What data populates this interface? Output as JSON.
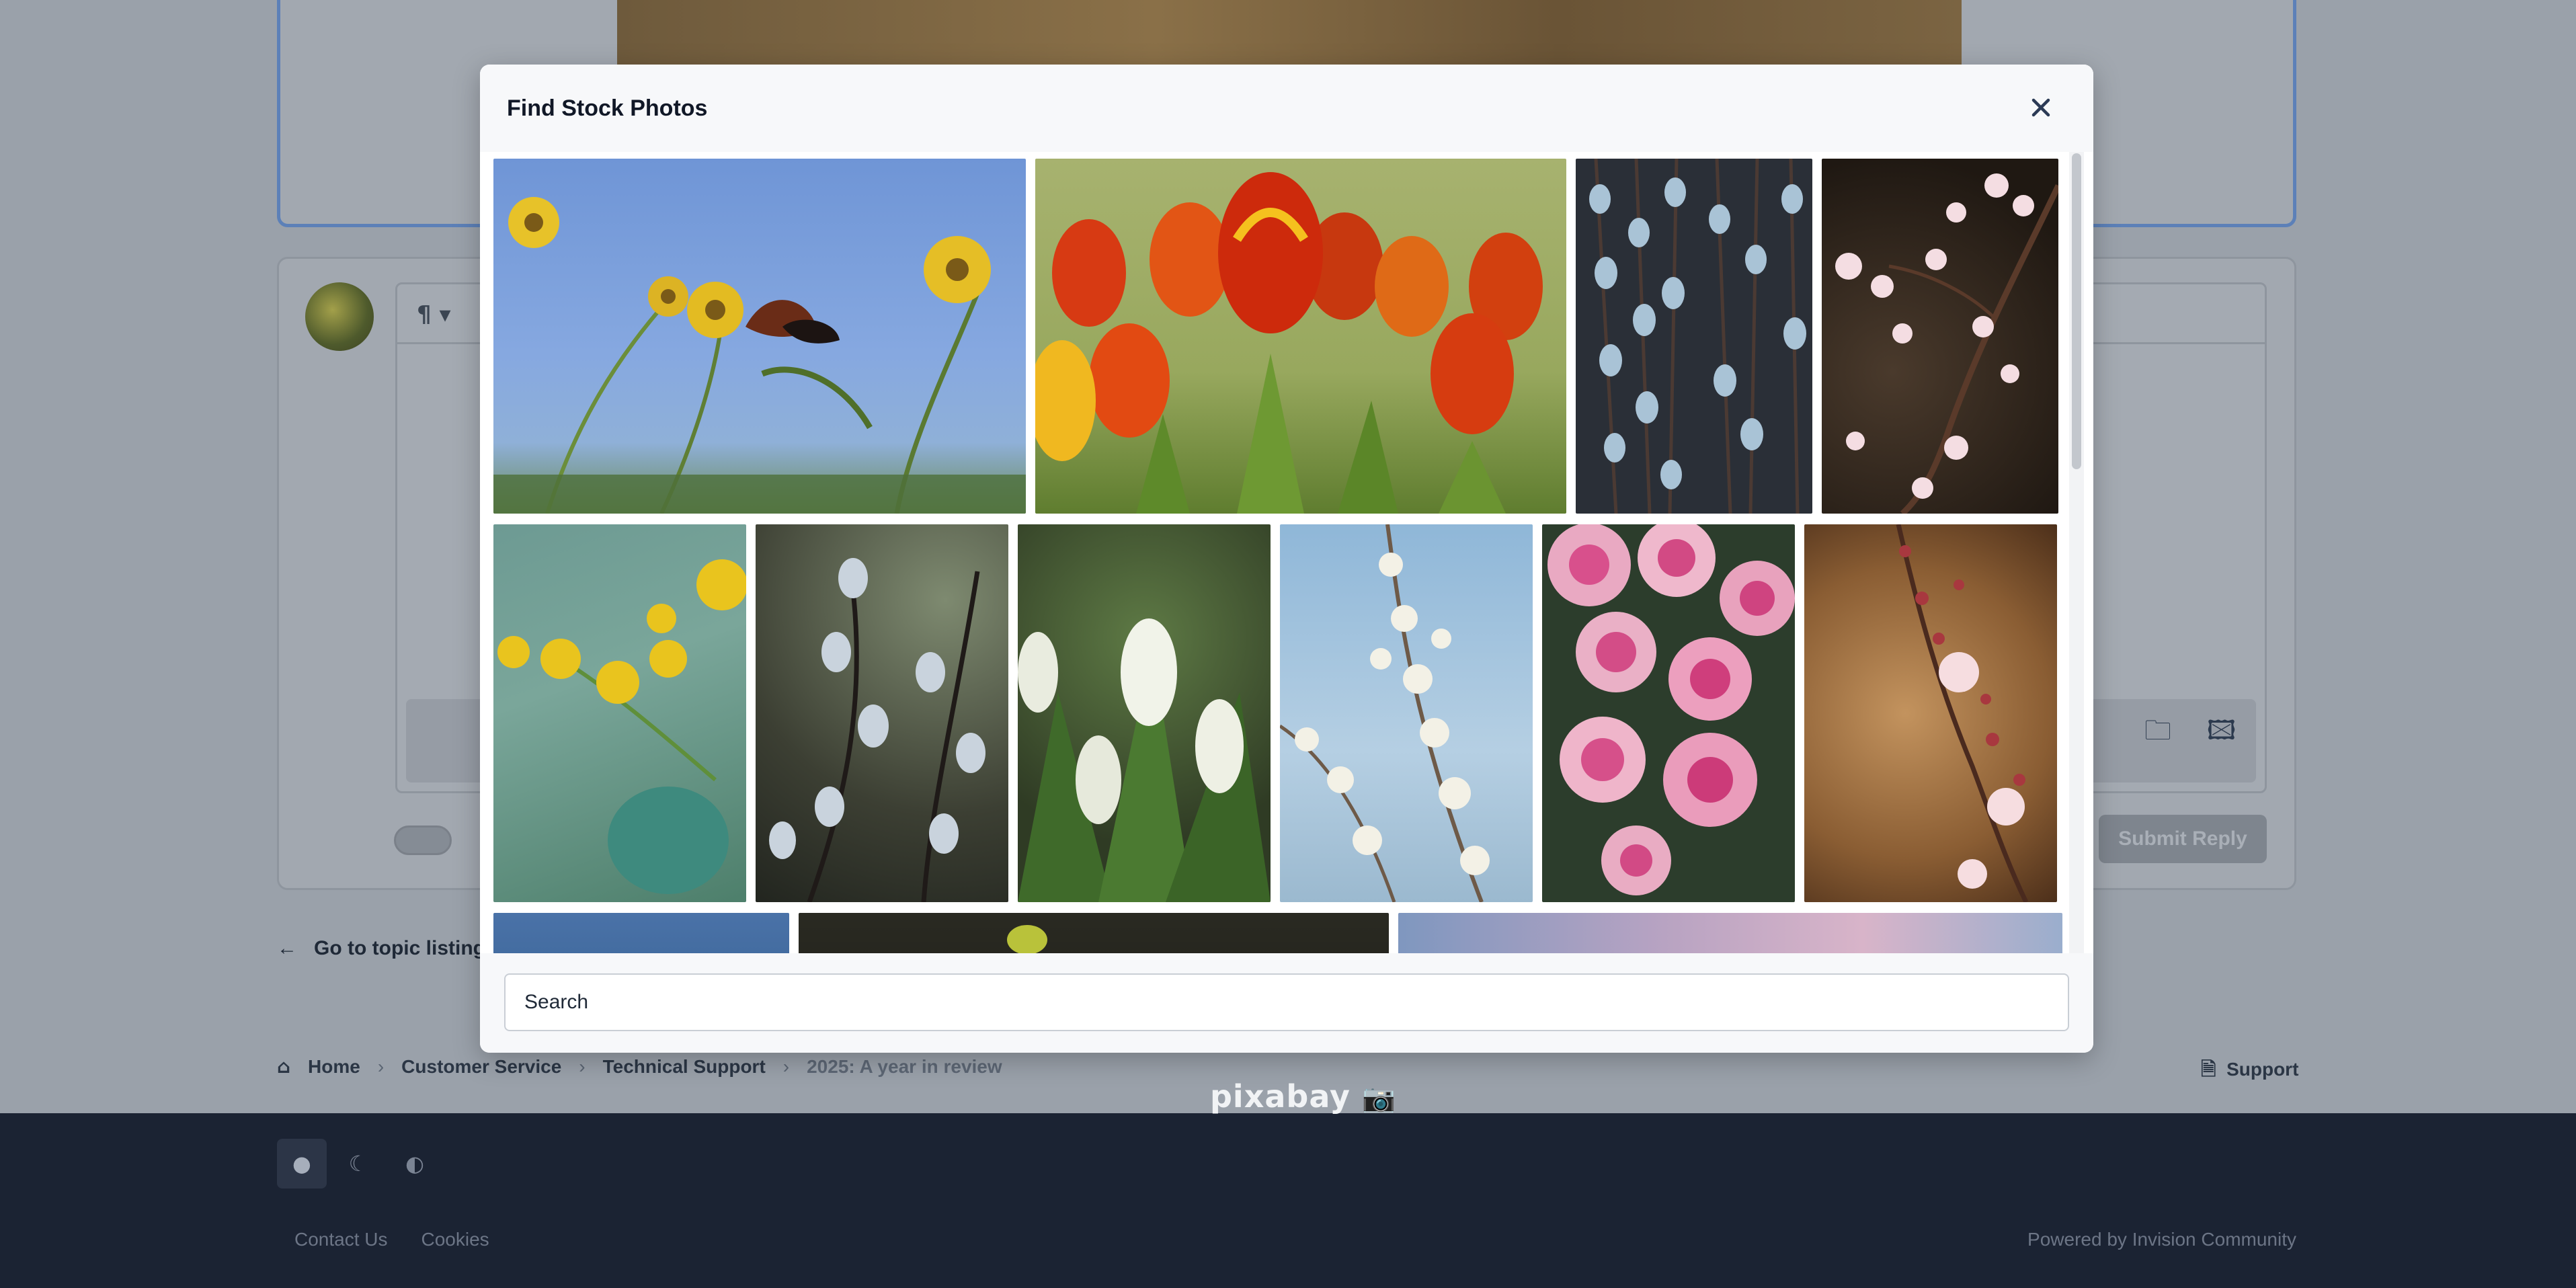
{
  "modal": {
    "title": "Find Stock Photos",
    "search_placeholder": "Search"
  },
  "photos": [
    {
      "name": "photo-butterfly-yellow-flowers"
    },
    {
      "name": "photo-red-yellow-tulips"
    },
    {
      "name": "photo-pussy-willow-white"
    },
    {
      "name": "photo-pink-blossom-branch-dark"
    },
    {
      "name": "photo-yellow-marsh-marigold"
    },
    {
      "name": "photo-pussy-willow-bokeh"
    },
    {
      "name": "photo-white-tulips"
    },
    {
      "name": "photo-white-blossom-blue-sky"
    },
    {
      "name": "photo-pink-roses"
    },
    {
      "name": "photo-cherry-blossom-brown"
    },
    {
      "name": "photo-partial-blue"
    },
    {
      "name": "photo-partial-dark"
    },
    {
      "name": "photo-partial-pink"
    }
  ],
  "background": {
    "goto_label": "Go to topic listing",
    "submit_label": "Submit Reply",
    "breadcrumbs": [
      "Home",
      "Customer Service",
      "Technical Support",
      "2025: A year in review"
    ],
    "support_label": "Support",
    "footer_links": [
      "Contact Us",
      "Cookies"
    ],
    "powered_by": "Powered by Invision Community",
    "pixabay_logo": "pixabay"
  }
}
